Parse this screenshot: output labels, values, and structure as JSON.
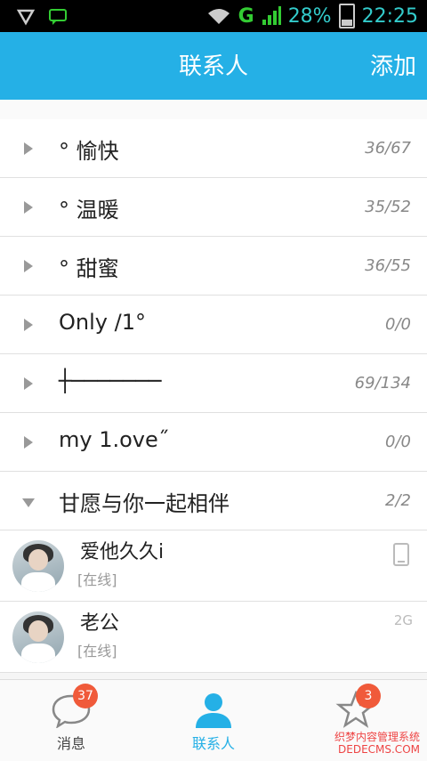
{
  "status_bar": {
    "network": "G",
    "battery": "28%",
    "time": "22:25"
  },
  "header": {
    "title": "联系人",
    "add_label": "添加"
  },
  "groups": [
    {
      "name": "° 愉快",
      "count": "36/67"
    },
    {
      "name": "° 温暖",
      "count": "35/52"
    },
    {
      "name": "° 甜蜜",
      "count": "36/55"
    },
    {
      "name": "Only /1°",
      "count": "0/0"
    },
    {
      "name": "┼───────",
      "count": "69/134"
    },
    {
      "name": "my 1.ove˝",
      "count": "0/0"
    },
    {
      "name": "甘愿与你一起相伴",
      "count": "2/2",
      "expanded": true
    }
  ],
  "contacts": [
    {
      "name": "爱他久久i",
      "status": "[在线]",
      "device": "phone-icon"
    },
    {
      "name": "老公",
      "status": "[在线]",
      "device_text": "2G"
    }
  ],
  "tabs": [
    {
      "label": "消息",
      "badge": "37",
      "icon": "message-bubble-icon"
    },
    {
      "label": "联系人",
      "icon": "contacts-person-icon",
      "active": true
    },
    {
      "label": "",
      "badge": "3",
      "icon": "star-icon"
    }
  ],
  "watermark": {
    "line1": "织梦内容管理系统",
    "line2": "DEDECMS.COM"
  },
  "colors": {
    "accent": "#25b0e6",
    "badge": "#f05a3a"
  }
}
